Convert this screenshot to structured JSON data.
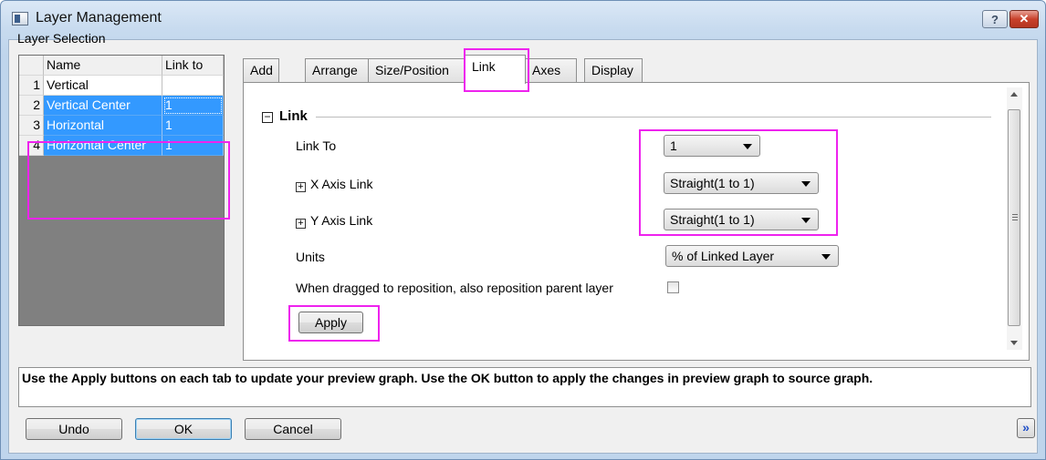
{
  "window": {
    "title": "Layer Management",
    "help_label": "?",
    "close_label": "✕"
  },
  "layer_selection": {
    "label": "Layer Selection",
    "columns": [
      "Name",
      "Link to"
    ],
    "rows": [
      {
        "index": "1",
        "name": "Vertical",
        "link_to": "",
        "selected": false
      },
      {
        "index": "2",
        "name": "Vertical Center",
        "link_to": "1",
        "selected": true
      },
      {
        "index": "3",
        "name": "Horizontal",
        "link_to": "1",
        "selected": true
      },
      {
        "index": "4",
        "name": "Horizontal Center",
        "link_to": "1",
        "selected": true
      }
    ]
  },
  "tabs": [
    {
      "label": "Add",
      "active": false
    },
    {
      "label": "Arrange",
      "active": false
    },
    {
      "label": "Size/Position",
      "active": false
    },
    {
      "label": "Link",
      "active": true
    },
    {
      "label": "Axes",
      "active": false
    },
    {
      "label": "Display",
      "active": false
    }
  ],
  "link_section": {
    "toggle": "−",
    "title": "Link",
    "link_to_label": "Link To",
    "link_to_value": "1",
    "x_axis_link_label": "X Axis Link",
    "x_axis_link_value": "Straight(1 to 1)",
    "y_axis_link_label": "Y Axis Link",
    "y_axis_link_value": "Straight(1 to 1)",
    "expand_symbol": "+",
    "units_label": "Units",
    "units_value": "% of Linked Layer",
    "reposition_label": "When dragged to reposition, also reposition parent layer",
    "reposition_checked": false,
    "apply_label": "Apply"
  },
  "status_text": "Use the Apply buttons on each tab to update your preview graph. Use the OK button to apply the changes in preview graph to source graph.",
  "footer": {
    "undo_label": "Undo",
    "ok_label": "OK",
    "cancel_label": "Cancel",
    "expand_label": "»"
  },
  "colors": {
    "highlight": "#ee22ee",
    "selection": "#3399ff"
  }
}
